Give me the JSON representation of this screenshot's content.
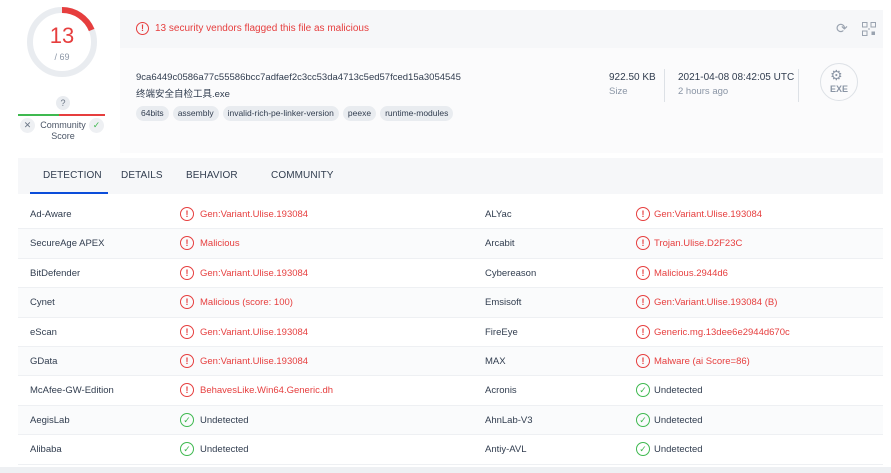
{
  "score": {
    "detections": "13",
    "total": "/ 69",
    "ratio": 0.1884,
    "ring_color": "#e63e3e",
    "track_color": "#e9ecf0"
  },
  "community": {
    "question": "?",
    "label": "Community Score",
    "down_icon": "x-icon",
    "up_icon": "check-icon"
  },
  "alert": {
    "text": "13 security vendors flagged this file as malicious",
    "icon": "!",
    "color": "#e63e3e"
  },
  "header_icons": {
    "reload": "⟳",
    "qr": "qr-scan-icon"
  },
  "file": {
    "hash": "9ca6449c0586a77c55586bcc7adfaef2c3cc53da4713c5ed57fced15a3054545",
    "name": "终端安全自检工具.exe",
    "tags": [
      "64bits",
      "assembly",
      "invalid-rich-pe-linker-version",
      "peexe",
      "runtime-modules"
    ],
    "size_value": "922.50 KB",
    "size_label": "Size",
    "date_value": "2021-04-08 08:42:05 UTC",
    "date_label": "2 hours ago",
    "type_label": "EXE",
    "type_icon": "exe-file-icon"
  },
  "tabs": [
    {
      "label": "DETECTION",
      "active": true
    },
    {
      "label": "DETAILS",
      "active": false
    },
    {
      "label": "BEHAVIOR",
      "active": false
    },
    {
      "label": "COMMUNITY",
      "active": false
    }
  ],
  "detections": [
    {
      "left": {
        "engine": "Ad-Aware",
        "result": "Gen:Variant.Ulise.193084",
        "status": "malicious"
      },
      "right": {
        "engine": "ALYac",
        "result": "Gen:Variant.Ulise.193084",
        "status": "malicious"
      }
    },
    {
      "left": {
        "engine": "SecureAge APEX",
        "result": "Malicious",
        "status": "malicious"
      },
      "right": {
        "engine": "Arcabit",
        "result": "Trojan.Ulise.D2F23C",
        "status": "malicious"
      }
    },
    {
      "left": {
        "engine": "BitDefender",
        "result": "Gen:Variant.Ulise.193084",
        "status": "malicious"
      },
      "right": {
        "engine": "Cybereason",
        "result": "Malicious.2944d6",
        "status": "malicious"
      }
    },
    {
      "left": {
        "engine": "Cynet",
        "result": "Malicious (score: 100)",
        "status": "malicious"
      },
      "right": {
        "engine": "Emsisoft",
        "result": "Gen:Variant.Ulise.193084 (B)",
        "status": "malicious"
      }
    },
    {
      "left": {
        "engine": "eScan",
        "result": "Gen:Variant.Ulise.193084",
        "status": "malicious"
      },
      "right": {
        "engine": "FireEye",
        "result": "Generic.mg.13dee6e2944d670c",
        "status": "malicious"
      }
    },
    {
      "left": {
        "engine": "GData",
        "result": "Gen:Variant.Ulise.193084",
        "status": "malicious"
      },
      "right": {
        "engine": "MAX",
        "result": "Malware (ai Score=86)",
        "status": "malicious"
      }
    },
    {
      "left": {
        "engine": "McAfee-GW-Edition",
        "result": "BehavesLike.Win64.Generic.dh",
        "status": "malicious"
      },
      "right": {
        "engine": "Acronis",
        "result": "Undetected",
        "status": "undetected"
      }
    },
    {
      "left": {
        "engine": "AegisLab",
        "result": "Undetected",
        "status": "undetected"
      },
      "right": {
        "engine": "AhnLab-V3",
        "result": "Undetected",
        "status": "undetected"
      }
    },
    {
      "left": {
        "engine": "Alibaba",
        "result": "Undetected",
        "status": "undetected"
      },
      "right": {
        "engine": "Antiy-AVL",
        "result": "Undetected",
        "status": "undetected"
      }
    }
  ],
  "colors": {
    "malicious": "#e63e3e",
    "undetected": "#3fb950",
    "accent": "#0b4dda"
  }
}
